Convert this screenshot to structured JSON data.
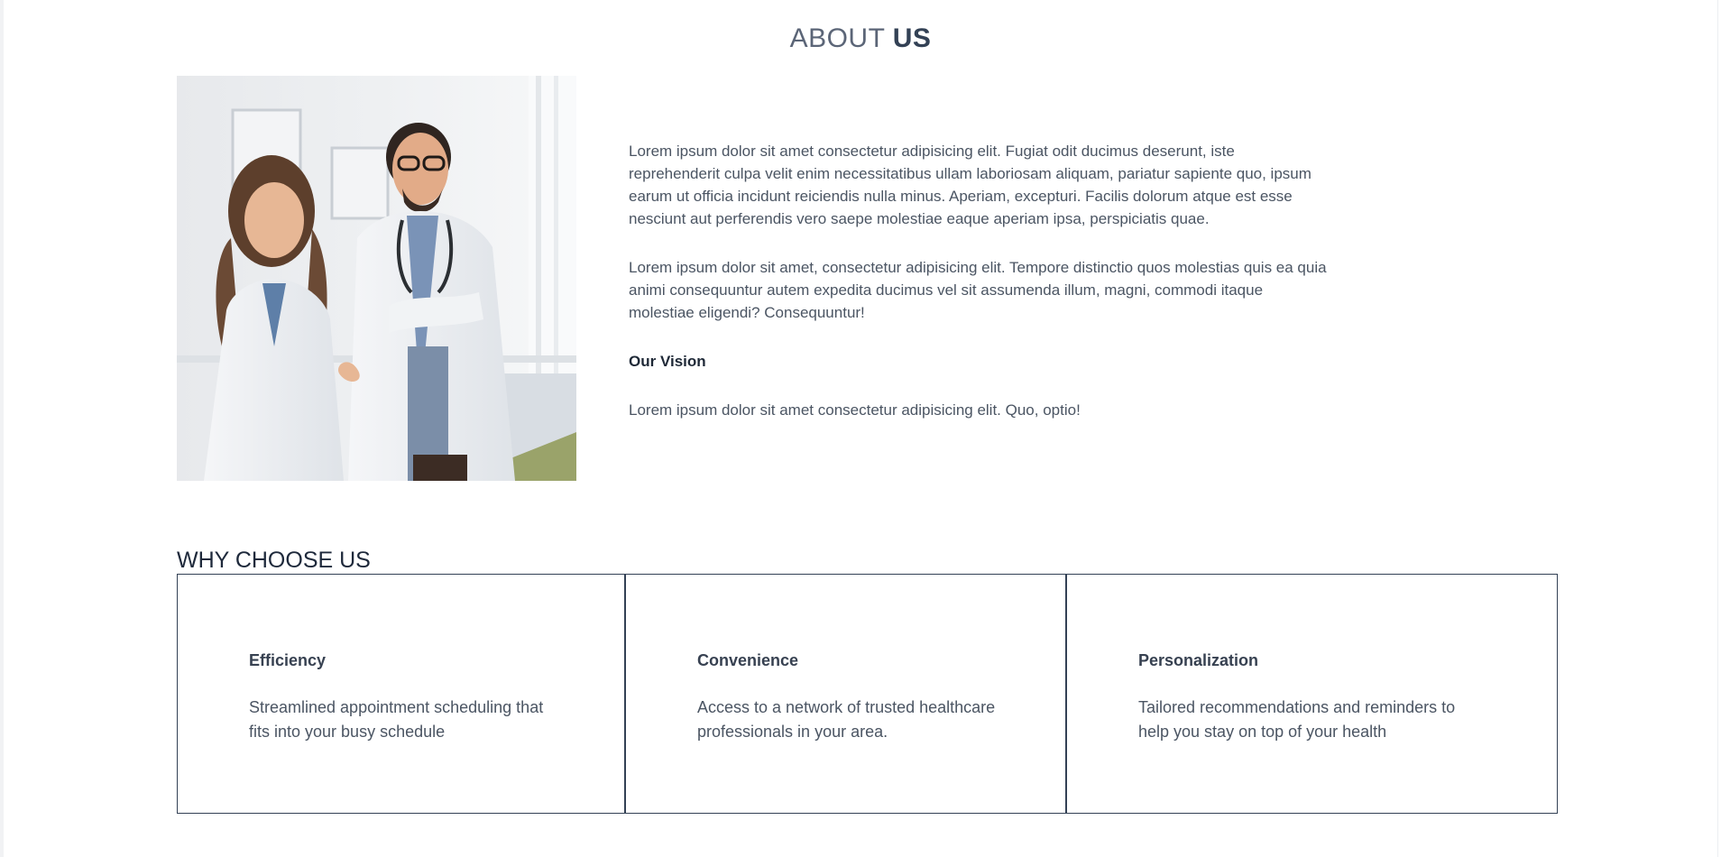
{
  "about": {
    "heading_light": "ABOUT",
    "heading_strong": "US",
    "paragraph_1": "Lorem ipsum dolor sit amet consectetur adipisicing elit. Fugiat odit ducimus deserunt, iste reprehenderit culpa velit enim necessitatibus ullam laboriosam aliquam, pariatur sapiente quo, ipsum earum ut officia incidunt reiciendis nulla minus. Aperiam, excepturi. Facilis dolorum atque est esse nesciunt aut perferendis vero saepe molestiae eaque aperiam ipsa, perspiciatis quae.",
    "paragraph_2": "Lorem ipsum dolor sit amet, consectetur adipisicing elit. Tempore distinctio quos molestias quis ea quia animi consequuntur autem expedita ducimus vel sit assumenda illum, magni, commodi itaque molestiae eligendi? Consequuntur!",
    "vision_title": "Our Vision",
    "vision_text": "Lorem ipsum dolor sit amet consectetur adipisicing elit. Quo, optio!"
  },
  "why": {
    "heading": "WHY CHOOSE US",
    "cards": [
      {
        "title": "Efficiency",
        "description": "Streamlined appointment scheduling that fits into your busy schedule"
      },
      {
        "title": "Convenience",
        "description": "Access to a network of trusted healthcare professionals in your area."
      },
      {
        "title": "Personalization",
        "description": "Tailored recommendations and reminders to help you stay on top of your health"
      }
    ]
  },
  "colors": {
    "heading_dark": "#334155",
    "text": "#4b5563",
    "card_border": "#334155"
  }
}
